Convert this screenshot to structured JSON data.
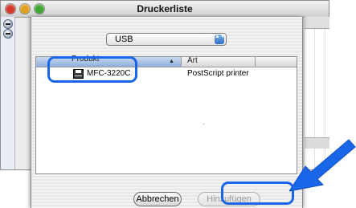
{
  "window": {
    "title": "Druckerliste"
  },
  "sheet": {
    "connection_popup": {
      "selected": "USB",
      "arrows_glyph": "▲▼"
    },
    "list": {
      "columns": [
        {
          "label": "Produkt"
        },
        {
          "label": "Art"
        }
      ],
      "sort_glyph": "▲",
      "rows": [
        {
          "name": "MFC-3220C",
          "type": "PostScript printer",
          "icon": "printer-icon"
        }
      ]
    },
    "buttons": {
      "cancel": "Abbrechen",
      "add": "Hinzufügen"
    }
  },
  "annotations": {
    "highlight_color": "#1a66e8",
    "arrow_color": "#1a66e8"
  }
}
